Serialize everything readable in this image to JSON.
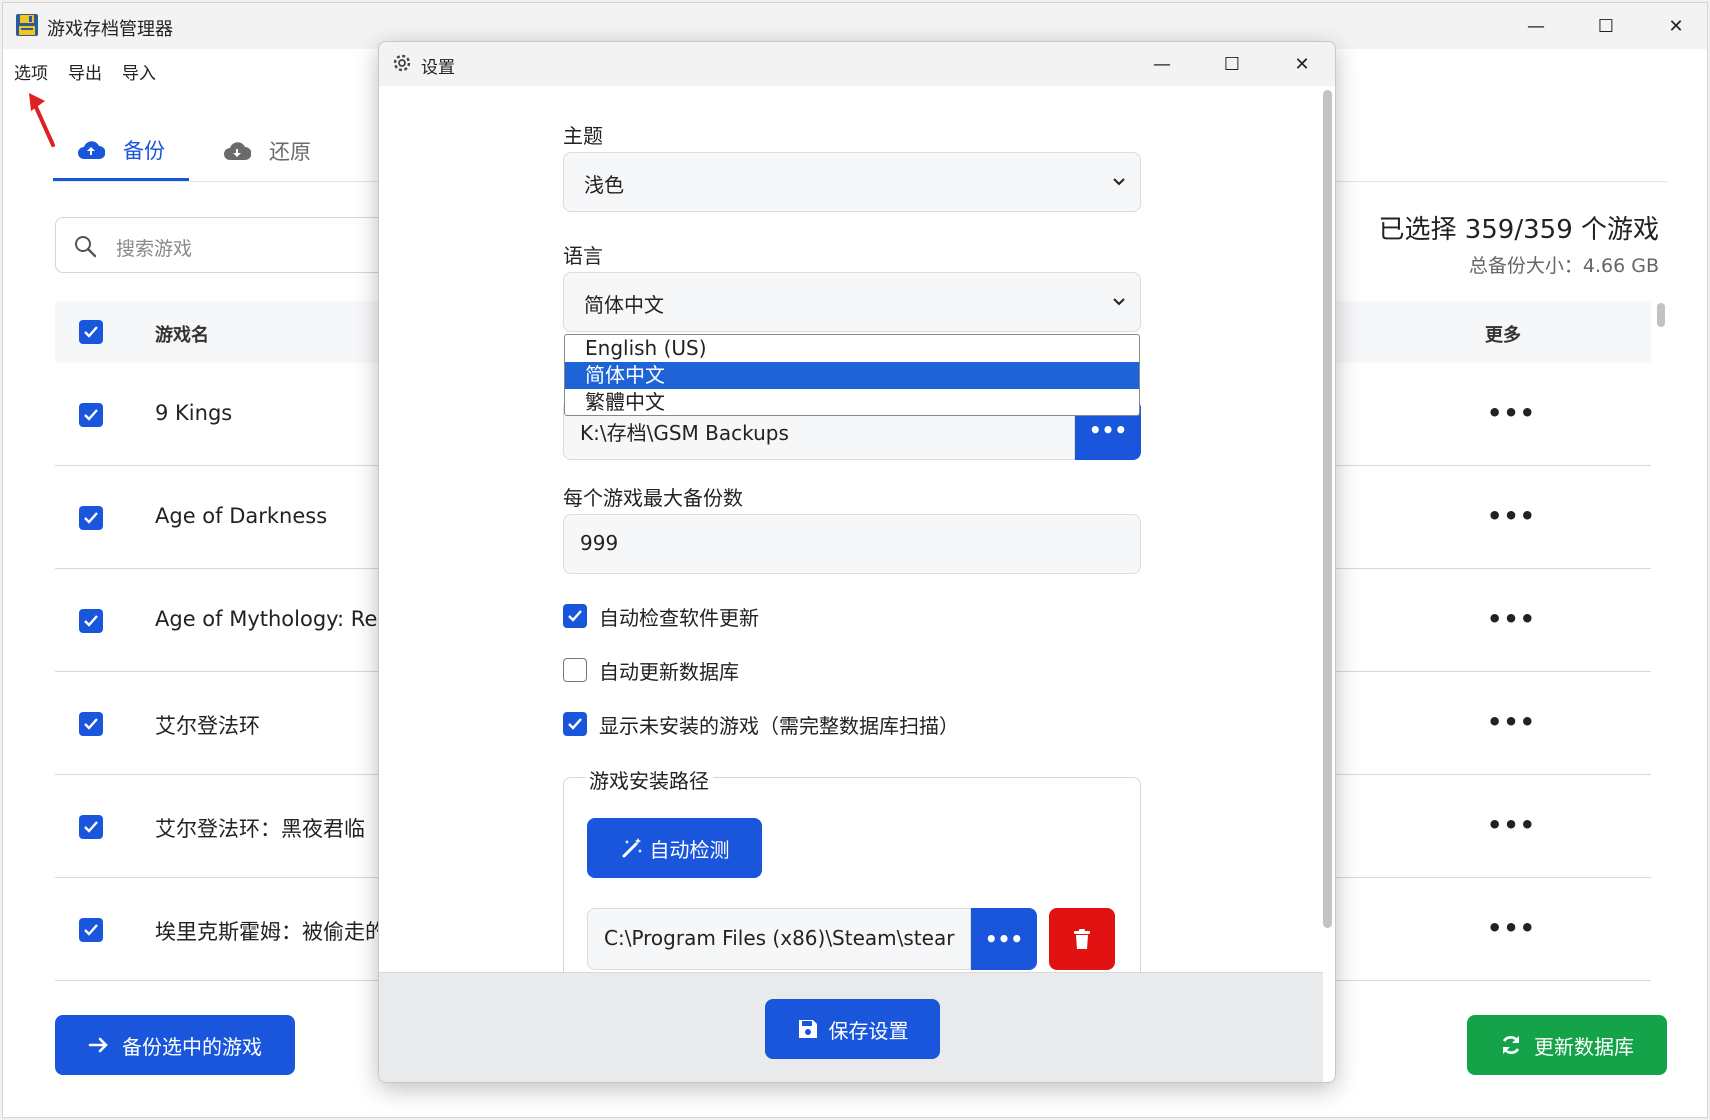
{
  "window": {
    "title": "游戏存档管理器",
    "controls": {
      "minimize": "—",
      "maximize": "☐",
      "close": "✕"
    }
  },
  "menu": {
    "options": "选项",
    "export": "导出",
    "import": "导入"
  },
  "tabs": {
    "backup": "备份",
    "restore": "还原"
  },
  "search": {
    "placeholder": "搜索游戏"
  },
  "summary": {
    "selected": "已选择 359/359 个游戏",
    "total_size": "总备份大小：4.66 GB"
  },
  "table": {
    "headers": {
      "name": "游戏名",
      "more": "更多"
    },
    "more_icon": "•••",
    "rows": [
      {
        "name": "9 Kings",
        "checked": true
      },
      {
        "name": "Age of Darkness",
        "checked": true
      },
      {
        "name": "Age of Mythology: Ret",
        "checked": true
      },
      {
        "name": "艾尔登法环",
        "checked": true
      },
      {
        "name": "艾尔登法环：黑夜君临",
        "checked": true
      },
      {
        "name": "埃里克斯霍姆：被偷走的",
        "checked": true
      }
    ]
  },
  "buttons": {
    "backup_selected": "备份选中的游戏",
    "update_database": "更新数据库"
  },
  "settings": {
    "title": "设置",
    "theme": {
      "label": "主题",
      "value": "浅色"
    },
    "language": {
      "label": "语言",
      "value": "简体中文",
      "options": [
        "English (US)",
        "简体中文",
        "繁體中文"
      ],
      "selected_index": 1
    },
    "backup_path": {
      "value": "K:\\存档\\GSM Backups",
      "browse": "•••"
    },
    "max_backups": {
      "label": "每个游戏最大备份数",
      "value": "999"
    },
    "checkboxes": [
      {
        "label": "自动检查软件更新",
        "checked": true
      },
      {
        "label": "自动更新数据库",
        "checked": false
      },
      {
        "label": "显示未安装的游戏（需完整数据库扫描）",
        "checked": true
      }
    ],
    "install_paths": {
      "legend": "游戏安装路径",
      "auto_detect": "自动检测",
      "path": "C:\\Program Files (x86)\\Steam\\stear",
      "browse": "•••"
    },
    "save": "保存设置"
  },
  "colors": {
    "primary": "#1a56db",
    "success": "#15a34a",
    "danger": "#e31212",
    "highlight": "#1f64d6",
    "annotation": "#e02020"
  }
}
